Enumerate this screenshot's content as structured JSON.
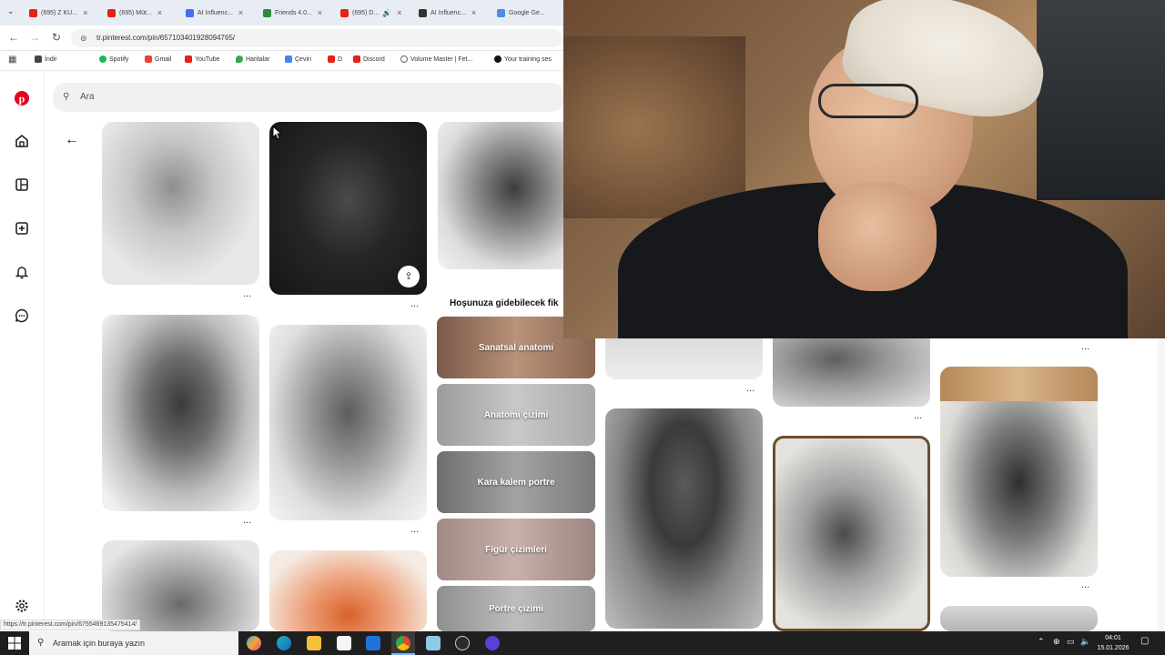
{
  "tabs": [
    {
      "label": "(695) Z KU...",
      "color": "#e62117"
    },
    {
      "label": "(695) Müt...",
      "color": "#e62117"
    },
    {
      "label": "AI Influenc...",
      "color": "#4a6cf7"
    },
    {
      "label": "Friends 4.0...",
      "color": "#2b8a3e"
    },
    {
      "label": "(695) D...",
      "color": "#e62117"
    },
    {
      "label": "AI Influenc...",
      "color": "#333333"
    },
    {
      "label": "Google Ge...",
      "color": "#4a90e2"
    }
  ],
  "address": {
    "url": "tr.pinterest.com/pin/657103401928094765/"
  },
  "bookmarks": [
    {
      "label": "İndir",
      "color": "#444"
    },
    {
      "label": "Spotify",
      "color": "#1db954"
    },
    {
      "label": "Gmail",
      "color": "#ea4335"
    },
    {
      "label": "YouTube",
      "color": "#e62117"
    },
    {
      "label": "Haritalar",
      "color": "#34a853"
    },
    {
      "label": "Çeviri",
      "color": "#4285f4"
    },
    {
      "label": "D",
      "color": "#e62117"
    },
    {
      "label": "Discord",
      "color": "#e62117"
    },
    {
      "label": "Volume Master | Fet...",
      "color": "#666"
    },
    {
      "label": "Your training ses",
      "color": "#111"
    }
  ],
  "search": {
    "placeholder": "Ara"
  },
  "suggestions": {
    "heading": "Hoşunuza gidebilecek fik",
    "chips": [
      {
        "label": "Sanatsal anatomi"
      },
      {
        "label": "Anatomi çizimi"
      },
      {
        "label": "Kara kalem portre"
      },
      {
        "label": "Figür çizimleri"
      },
      {
        "label": "Portre çizimi"
      }
    ]
  },
  "pin_more_label": "...",
  "status_url": "https://tr.pinterest.com/pin/6755469135475414/",
  "taskbar": {
    "search_placeholder": "Aramak için buraya yazın",
    "time": "04:01",
    "date": "15.01.2026"
  },
  "colors": {
    "pinterest_red": "#e60023",
    "taskbar": "#1f1f1f"
  }
}
